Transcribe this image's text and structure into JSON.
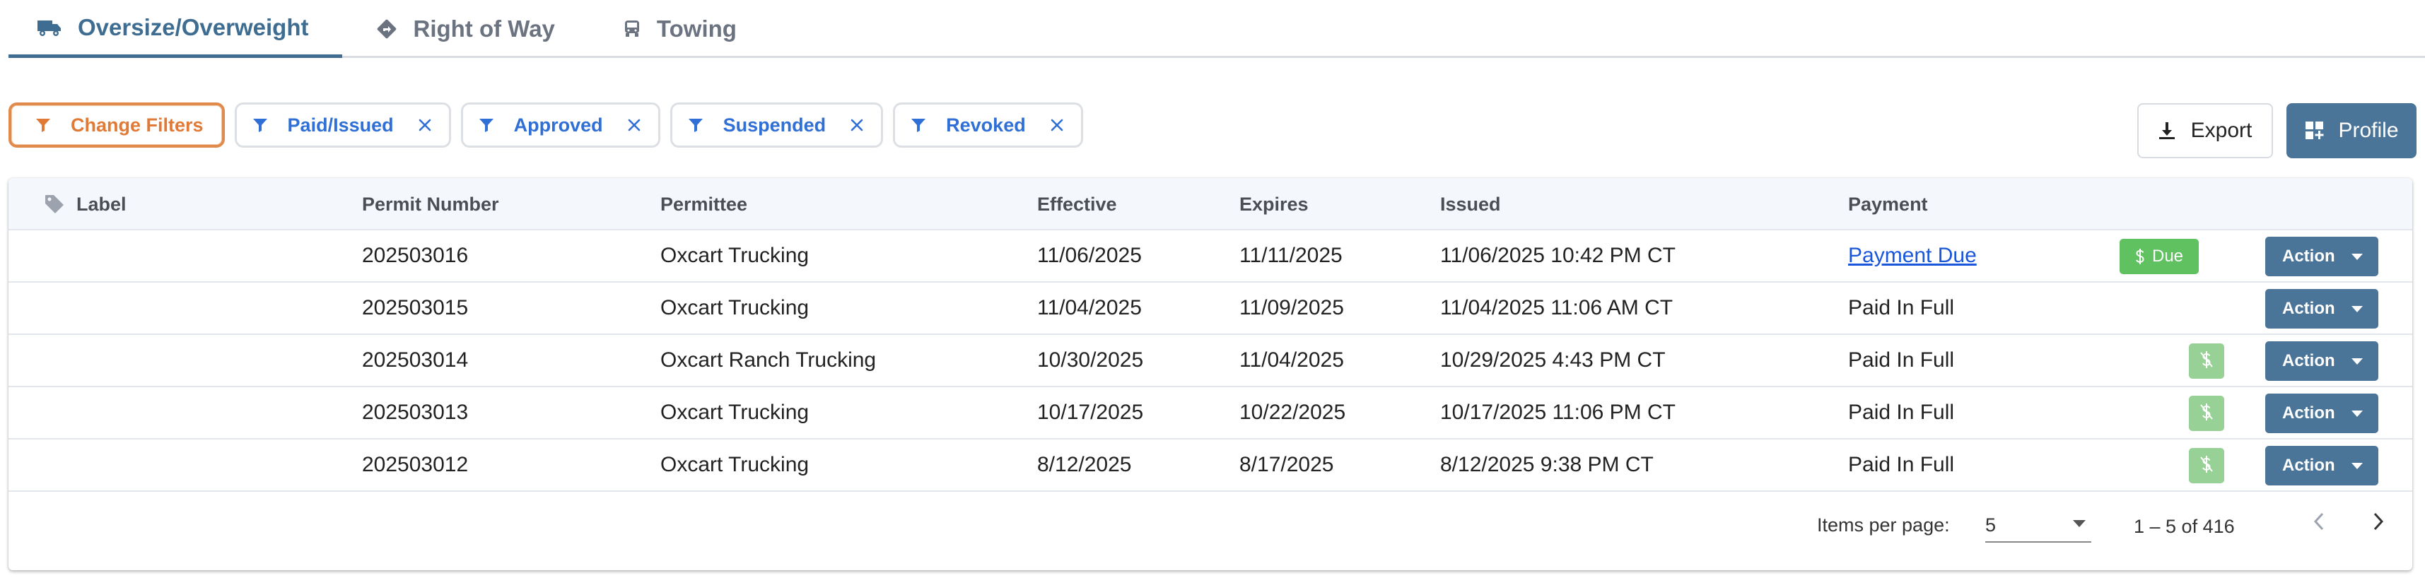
{
  "tabs": [
    {
      "label": "Oversize/Overweight",
      "icon": "truck-icon",
      "active": true
    },
    {
      "label": "Right of Way",
      "icon": "directions-diamond-icon",
      "active": false
    },
    {
      "label": "Towing",
      "icon": "tow-truck-icon",
      "active": false
    }
  ],
  "filters": {
    "change_label": "Change Filters",
    "chips": [
      "Paid/Issued",
      "Approved",
      "Suspended",
      "Revoked"
    ]
  },
  "toolbar": {
    "export_label": "Export",
    "profile_label": "Profile"
  },
  "table": {
    "headers": {
      "label": "Label",
      "permit_number": "Permit Number",
      "permittee": "Permittee",
      "effective": "Effective",
      "expires": "Expires",
      "issued": "Issued",
      "payment": "Payment"
    },
    "rows": [
      {
        "permit": "202503016",
        "permittee": "Oxcart Trucking",
        "effective": "11/06/2025",
        "expires": "11/11/2025",
        "issued": "11/06/2025 10:42 PM CT",
        "payment": "Payment Due",
        "due_badge": "Due",
        "action": "Action"
      },
      {
        "permit": "202503015",
        "permittee": "Oxcart Trucking",
        "effective": "11/04/2025",
        "expires": "11/09/2025",
        "issued": "11/04/2025 11:06 AM CT",
        "payment": "Paid In Full",
        "action": "Action"
      },
      {
        "permit": "202503014",
        "permittee": "Oxcart Ranch Trucking",
        "effective": "10/30/2025",
        "expires": "11/04/2025",
        "issued": "10/29/2025 4:43 PM CT",
        "payment": "Paid In Full",
        "action": "Action"
      },
      {
        "permit": "202503013",
        "permittee": "Oxcart Trucking",
        "effective": "10/17/2025",
        "expires": "10/22/2025",
        "issued": "10/17/2025 11:06 PM CT",
        "payment": "Paid In Full",
        "action": "Action"
      },
      {
        "permit": "202503012",
        "permittee": "Oxcart Trucking",
        "effective": "8/12/2025",
        "expires": "8/17/2025",
        "issued": "8/12/2025 9:38 PM CT",
        "payment": "Paid In Full",
        "action": "Action"
      }
    ]
  },
  "paginator": {
    "items_per_page_label": "Items per page:",
    "items_per_page": "5",
    "range": "1 – 5 of 416"
  },
  "colors": {
    "primary": "#4a7498",
    "active_tab": "#3e6d91",
    "filter_chip_text": "#2f6fd6",
    "change_filters": "#e07a36",
    "due_badge": "#5fc15f",
    "paid_badge": "#97d195",
    "link": "#1a56db"
  }
}
